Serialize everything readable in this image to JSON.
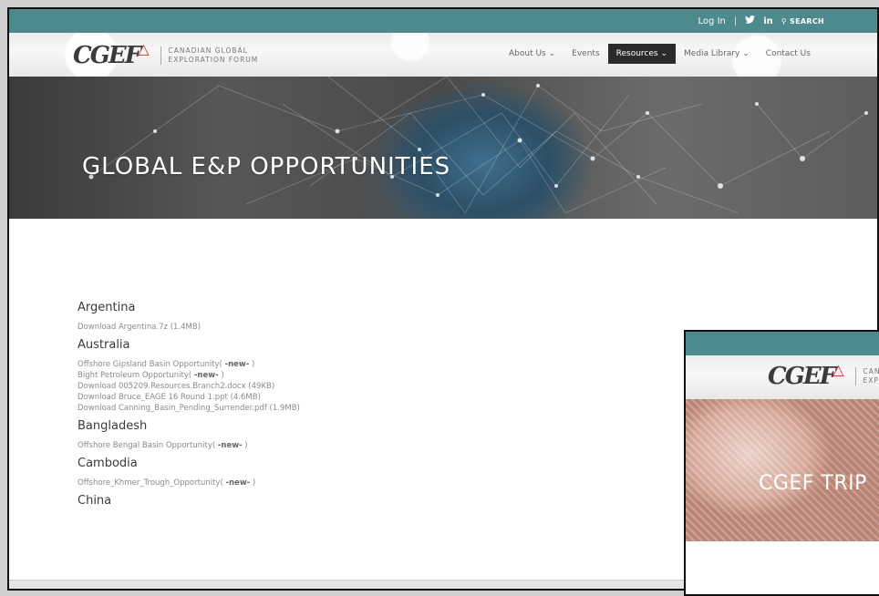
{
  "main_window": {
    "topbar": {
      "login": "Log In",
      "separator": "|",
      "twitter_icon": "twitter-icon",
      "linkedin_icon": "in",
      "search_label": "SEARCH"
    },
    "logo": {
      "mark": "CGEF",
      "line1": "CANADIAN GLOBAL",
      "line2": "EXPLORATION FORUM"
    },
    "nav": [
      {
        "label": "About Us",
        "dropdown": true
      },
      {
        "label": "Events",
        "dropdown": false
      },
      {
        "label": "Resources",
        "dropdown": true,
        "active": true
      },
      {
        "label": "Media Library",
        "dropdown": true
      },
      {
        "label": "Contact Us",
        "dropdown": false
      }
    ],
    "hero_title": "GLOBAL E&P OPPORTUNITIES",
    "countries": [
      {
        "name": "Argentina",
        "files": [
          "Download Argentina.7z (1.4MB)"
        ]
      },
      {
        "name": "Australia",
        "files": [
          "Offshore Gipsland Basin Opportunity( -new- )",
          "Bight Petroleum Opportunity( -new- )",
          "Download 005209.Resources.Branch2.docx (49KB)",
          "Download Bruce_EAGE 16 Round 1.ppt (4.6MB)",
          "Download Canning_Basin_Pending_Surrender.pdf (1.9MB)"
        ]
      },
      {
        "name": "Bangladesh",
        "files": [
          "Offshore Bengal Basin Opportunity( -new- )"
        ]
      },
      {
        "name": "Cambodia",
        "files": [
          "Offshore_Khmer_Trough_Opportunity( -new- )"
        ]
      },
      {
        "name": "China",
        "files": []
      }
    ]
  },
  "second_window": {
    "logo_mark": "CGEF",
    "logo_line1": "CANADIA",
    "logo_line2": "EXPLOR",
    "hero_title": "CGEF TRIP"
  },
  "colors": {
    "teal": "#4d8a8e",
    "nav_active_bg": "#2b2b2b",
    "logo_accent": "#c0392b"
  }
}
